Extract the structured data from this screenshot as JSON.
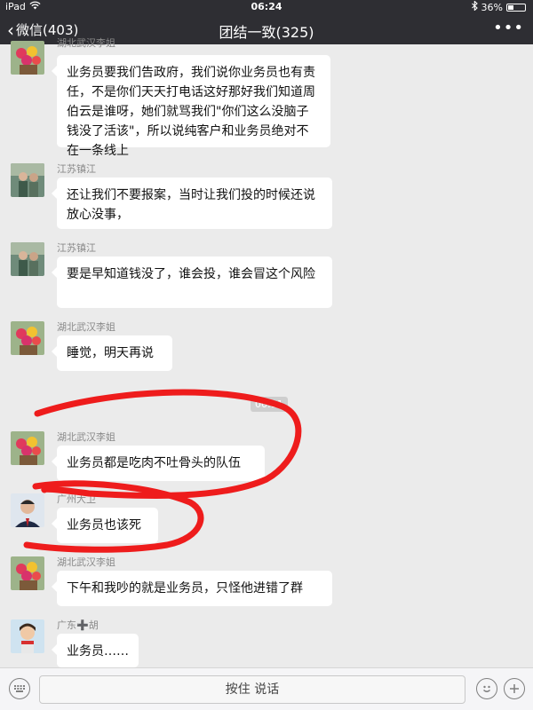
{
  "status_bar": {
    "device": "iPad",
    "time": "06:24",
    "battery": "36%",
    "battery_level": 0.36
  },
  "nav": {
    "back_label": "微信(403)",
    "title": "团结一致(325)"
  },
  "messages": [
    {
      "sender": "湖北武汉李姐",
      "text": "业务员要我们告政府，我们说你业务员也有责任，不是你们天天打电话这好那好我们知道周伯云是谁呀，她们就骂我们\"你们这么没脑子钱没了活该\"，所以说纯客户和业务员绝对不在一条线上"
    },
    {
      "sender": "江苏镇江",
      "text": "还让我们不要报案，当时让我们投的时候还说放心没事，"
    },
    {
      "sender": "江苏镇江",
      "text": "要是早知道钱没了，谁会投，谁会冒这个风险"
    },
    {
      "sender": "湖北武汉李姐",
      "text": "睡觉，明天再说"
    },
    {
      "sender": "湖北武汉李姐",
      "text": "业务员都是吃肉不吐骨头的队伍"
    },
    {
      "sender": "广州大卫",
      "text": "业务员也该死"
    },
    {
      "sender": "湖北武汉李姐",
      "text": "下午和我吵的就是业务员，只怪他进错了群"
    },
    {
      "sender": "广东➕胡",
      "text": "业务员……"
    }
  ],
  "timestamp": "00:11",
  "input_bar": {
    "hold_to_talk": "按住 说话"
  },
  "colors": {
    "nav_bg": "#2e2e33",
    "chat_bg": "#ebebeb",
    "bubble_bg": "#ffffff",
    "annotation_red": "#ee1c1c"
  }
}
